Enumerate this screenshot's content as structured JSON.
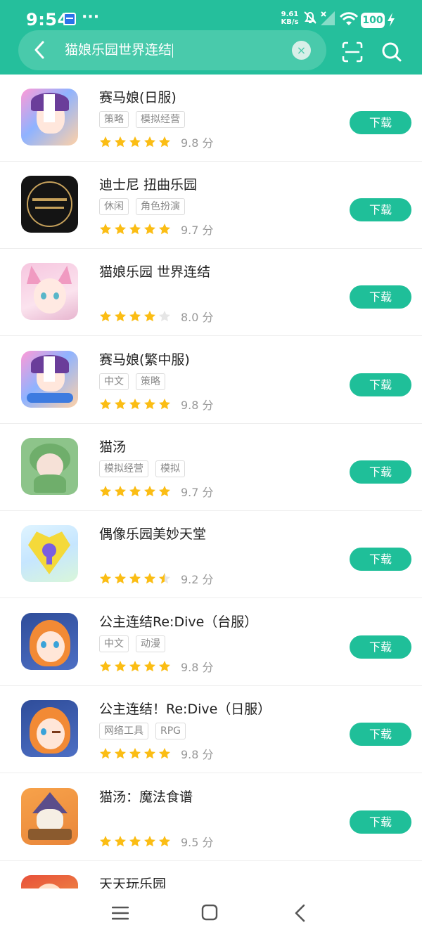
{
  "status_bar": {
    "time": "9:54",
    "speed_value": "9.61",
    "speed_unit": "KB/s",
    "battery": "100",
    "icons": [
      "calendar-notification-icon",
      "more-dots-icon",
      "mute-bell-icon",
      "no-signal-icon",
      "wifi-icon",
      "battery-icon",
      "charging-bolt-icon"
    ]
  },
  "search": {
    "query": "猫娘乐园世界连结",
    "clear_label": "×",
    "icons": [
      "back-arrow-icon",
      "clear-icon",
      "scan-icon",
      "search-icon"
    ]
  },
  "colors": {
    "primary": "#25bf9c",
    "button": "#1fbf99",
    "star": "#fbbd14",
    "star_empty": "#e6e6e6"
  },
  "results": [
    {
      "name": "赛马娘(日服)",
      "tags": [
        "策略",
        "模拟经营"
      ],
      "stars": 5,
      "score": "9.8 分",
      "button": "下载"
    },
    {
      "name": "迪士尼 扭曲乐园",
      "tags": [
        "休闲",
        "角色扮演"
      ],
      "stars": 5,
      "score": "9.7 分",
      "button": "下载"
    },
    {
      "name": "猫娘乐园 世界连结",
      "tags": [],
      "stars": 4,
      "score": "8.0 分",
      "button": "下载"
    },
    {
      "name": "赛马娘(繁中服)",
      "tags": [
        "中文",
        "策略"
      ],
      "stars": 5,
      "score": "9.8 分",
      "button": "下载"
    },
    {
      "name": "猫汤",
      "tags": [
        "模拟经营",
        "模拟"
      ],
      "stars": 5,
      "score": "9.7 分",
      "button": "下载"
    },
    {
      "name": "偶像乐园美妙天堂",
      "tags": [],
      "stars": 4.5,
      "score": "9.2 分",
      "button": "下载"
    },
    {
      "name": "公主连结Re:Dive（台服）",
      "tags": [
        "中文",
        "动漫"
      ],
      "stars": 5,
      "score": "9.8 分",
      "button": "下载"
    },
    {
      "name": "公主连结！Re:Dive（日服）",
      "tags": [
        "网络工具",
        "RPG"
      ],
      "stars": 5,
      "score": "9.8 分",
      "button": "下载"
    },
    {
      "name": "猫汤：魔法食谱",
      "tags": [],
      "stars": 5,
      "score": "9.5 分",
      "button": "下载"
    },
    {
      "name": "天天玩乐园",
      "tags": [],
      "stars": 0,
      "score": "",
      "button": ""
    }
  ],
  "nav": {
    "icons": [
      "menu-icon",
      "home-icon",
      "back-icon"
    ]
  }
}
